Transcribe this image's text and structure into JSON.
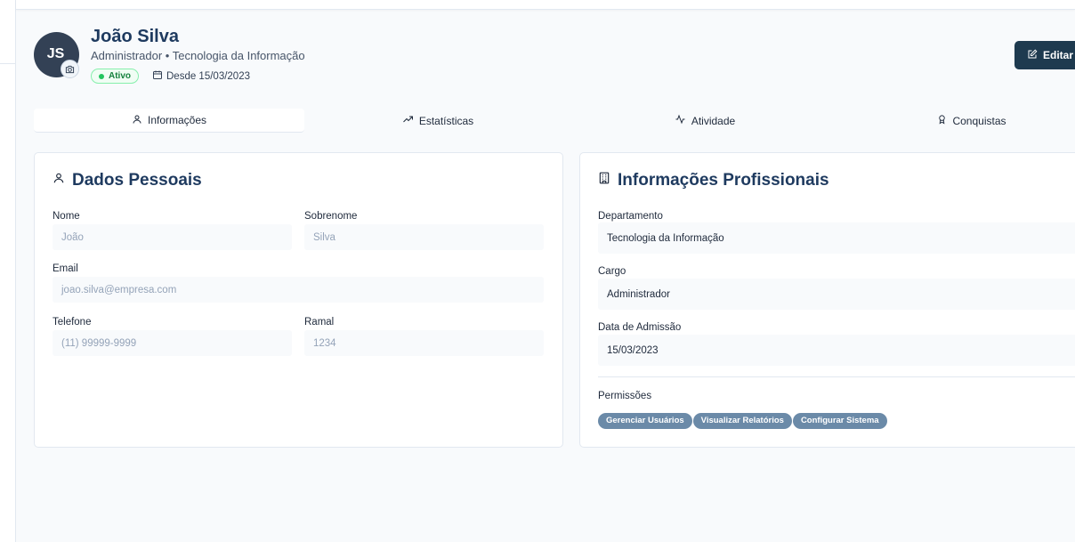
{
  "profile": {
    "initials": "JS",
    "name": "João Silva",
    "subtitle": "Administrador • Tecnologia da Informação",
    "status": "Ativo",
    "since": "Desde 15/03/2023",
    "edit_label": "Editar Perfil"
  },
  "tabs": [
    {
      "label": "Informações",
      "icon": "user-icon"
    },
    {
      "label": "Estatísticas",
      "icon": "trending-up-icon"
    },
    {
      "label": "Atividade",
      "icon": "activity-icon"
    },
    {
      "label": "Conquistas",
      "icon": "award-icon"
    }
  ],
  "personal": {
    "title": "Dados Pessoais",
    "first_name_label": "Nome",
    "first_name_placeholder": "João",
    "last_name_label": "Sobrenome",
    "last_name_placeholder": "Silva",
    "email_label": "Email",
    "email_placeholder": "joao.silva@empresa.com",
    "phone_label": "Telefone",
    "phone_placeholder": "(11) 99999-9999",
    "ext_label": "Ramal",
    "ext_placeholder": "1234"
  },
  "professional": {
    "title": "Informações Profissionais",
    "department_label": "Departamento",
    "department_value": "Tecnologia da Informação",
    "role_label": "Cargo",
    "role_value": "Administrador",
    "admission_label": "Data de Admissão",
    "admission_value": "15/03/2023",
    "permissions_label": "Permissões",
    "permissions": [
      "Gerenciar Usuários",
      "Visualizar Relatórios",
      "Configurar Sistema"
    ]
  },
  "colors": {
    "primary": "#1e3a4f",
    "status_green": "#22c55e",
    "permission_badge": "#6b8aa8"
  }
}
